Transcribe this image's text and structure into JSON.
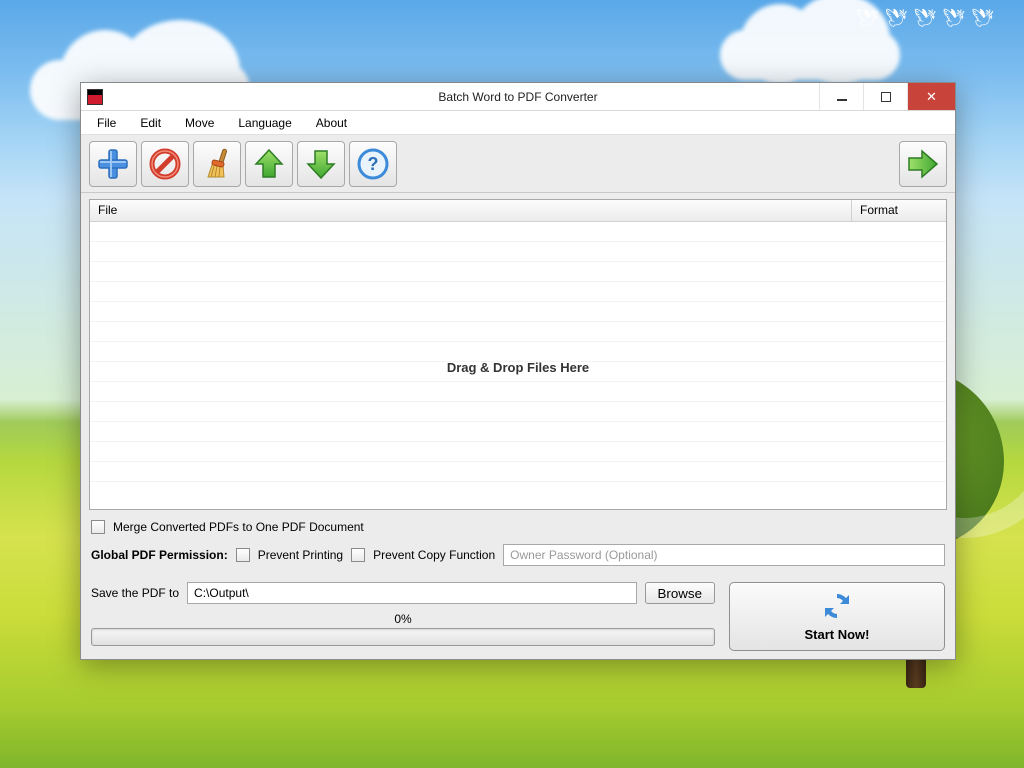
{
  "window": {
    "title": "Batch Word to PDF Converter"
  },
  "menu": {
    "file": "File",
    "edit": "Edit",
    "move": "Move",
    "language": "Language",
    "about": "About"
  },
  "list": {
    "col_file": "File",
    "col_format": "Format",
    "drop_hint": "Drag & Drop Files Here"
  },
  "opts": {
    "merge": "Merge Converted PDFs to One PDF Document",
    "perm_label": "Global PDF Permission:",
    "prevent_print": "Prevent Printing",
    "prevent_copy": "Prevent Copy Function",
    "owner_pw_placeholder": "Owner Password (Optional)",
    "save_label": "Save the PDF to",
    "save_path": "C:\\Output\\",
    "browse": "Browse"
  },
  "progress": {
    "pct": "0%"
  },
  "start": {
    "label": "Start Now!"
  }
}
